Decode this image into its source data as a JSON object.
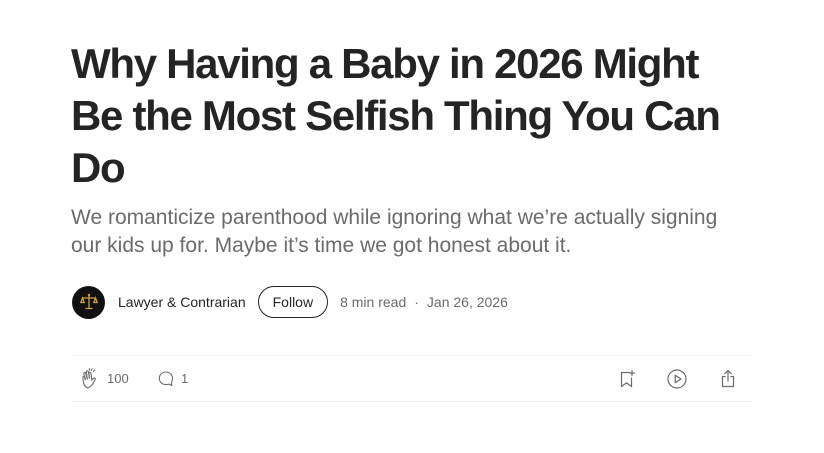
{
  "article": {
    "title": "Why Having a Baby in 2026 Might Be the Most Selfish Thing You Can Do",
    "subtitle": "We romanticize parenthood while ignoring what we’re actually signing our kids up for. Maybe it’s time we got honest about it."
  },
  "byline": {
    "avatar_icon": "scales-of-justice-icon",
    "author": "Lawyer & Contrarian",
    "follow_label": "Follow",
    "read_time": "8 min read",
    "separator": "·",
    "date": "Jan 26, 2026"
  },
  "actions": {
    "clap_icon": "clap-icon",
    "clap_count": "100",
    "comment_icon": "comment-icon",
    "comment_count": "1",
    "save_icon": "bookmark-add-icon",
    "listen_icon": "play-icon",
    "share_icon": "share-icon"
  },
  "colors": {
    "text": "#242424",
    "muted": "#6b6b6b",
    "divider": "#f2f2f2",
    "avatar_bg": "#111111",
    "avatar_accent": "#c9a23a"
  }
}
